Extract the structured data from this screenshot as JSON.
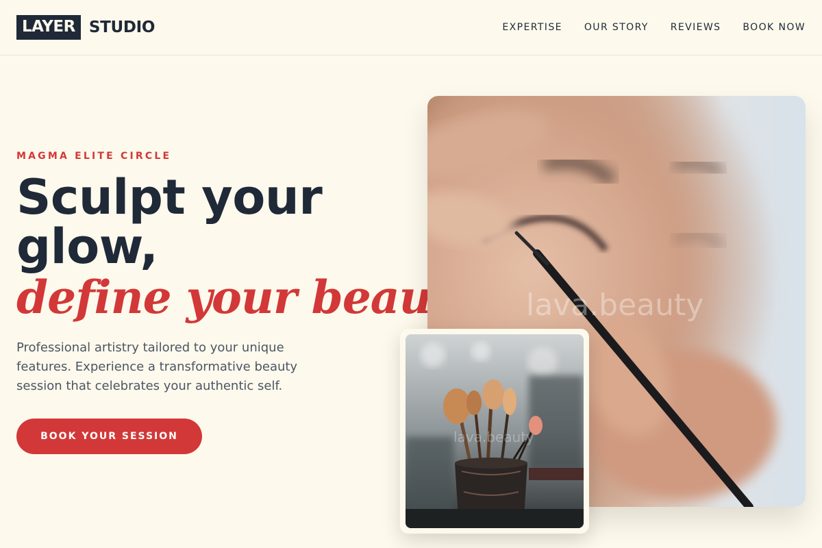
{
  "brand": {
    "logo_box": "LAYER",
    "logo_text": "STUDIO"
  },
  "nav": {
    "items": [
      "EXPERTISE",
      "OUR STORY",
      "REVIEWS",
      "BOOK NOW"
    ]
  },
  "hero": {
    "eyebrow": "MAGMA ELITE CIRCLE",
    "headline_line1": "Sculpt your glow,",
    "headline_accent": "define your beauty.",
    "lead": "Professional artistry tailored to your unique features. Experience a transformative beauty session that celebrates your authentic self.",
    "cta_label": "BOOK YOUR SESSION"
  },
  "images": {
    "main_watermark": "lava.beauty",
    "small_watermark": "lava.beauty"
  },
  "colors": {
    "background": "#fdf9ec",
    "accent": "#d23838",
    "ink": "#1f2937"
  }
}
